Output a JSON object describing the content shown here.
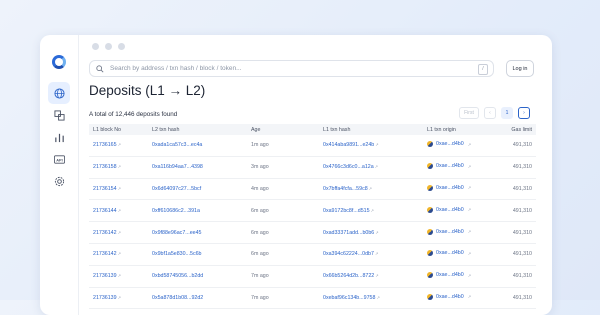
{
  "window": {
    "dots": 3
  },
  "sidebar": {
    "items": [
      {
        "icon": "globe-icon",
        "active": true
      },
      {
        "icon": "blocks-icon",
        "active": false
      },
      {
        "icon": "chart-icon",
        "active": false
      },
      {
        "icon": "api-icon",
        "active": false
      },
      {
        "icon": "gear-icon",
        "active": false
      }
    ],
    "api_label": "API"
  },
  "search": {
    "placeholder": "Search by address / txn hash / block / token...",
    "kbd": "/"
  },
  "header": {
    "login_label": "Log in"
  },
  "page": {
    "title": "Deposits (L1 → L2)",
    "count": "A total of 12,446 deposits found"
  },
  "pagination": {
    "first": "First",
    "prev": "‹",
    "current": "1",
    "next": "›"
  },
  "table": {
    "columns": [
      "L1 block No",
      "L2 txn hash",
      "Age",
      "L1 txn hash",
      "L1 txn origin",
      "Gas limit"
    ],
    "rows": [
      {
        "l1_block": "21736165",
        "l2_hash": "0xada1ca57c3...ec4a",
        "age": "1m ago",
        "l1_hash": "0x414aba9891...e24b",
        "origin": "0xae...d4b0",
        "gas": "491,310"
      },
      {
        "l1_block": "21736158",
        "l2_hash": "0xa116b94aa7...4398",
        "age": "3m ago",
        "l1_hash": "0x4766c3d6c0...a12a",
        "origin": "0xae...d4b0",
        "gas": "491,310"
      },
      {
        "l1_block": "21736154",
        "l2_hash": "0x6d64097c27...5bcf",
        "age": "4m ago",
        "l1_hash": "0x7bffa4fcfa...59c8",
        "origin": "0xae...d4b0",
        "gas": "491,310"
      },
      {
        "l1_block": "21736144",
        "l2_hash": "0xff610686c2...391a",
        "age": "6m ago",
        "l1_hash": "0xa9172bc8f...d515",
        "origin": "0xae...d4b0",
        "gas": "491,310"
      },
      {
        "l1_block": "21736142",
        "l2_hash": "0x9f88e96ac7...ee45",
        "age": "6m ago",
        "l1_hash": "0xad33371add...b0b6",
        "origin": "0xae...d4b0",
        "gas": "491,310"
      },
      {
        "l1_block": "21736142",
        "l2_hash": "0x9bf1a5e830...5c6b",
        "age": "6m ago",
        "l1_hash": "0xa394c62224...0db7",
        "origin": "0xae...d4b0",
        "gas": "491,310"
      },
      {
        "l1_block": "21736139",
        "l2_hash": "0xbd58745056...b2dd",
        "age": "7m ago",
        "l1_hash": "0x66b5264d2b...8722",
        "origin": "0xae...d4b0",
        "gas": "491,310"
      },
      {
        "l1_block": "21736139",
        "l2_hash": "0x5a878d1b08...92d2",
        "age": "7m ago",
        "l1_hash": "0xebaf96c134b...9758",
        "origin": "0xae...d4b0",
        "gas": "491,310"
      }
    ]
  },
  "colors": {
    "accent": "#2c64c9",
    "background": "#eef3fb"
  }
}
